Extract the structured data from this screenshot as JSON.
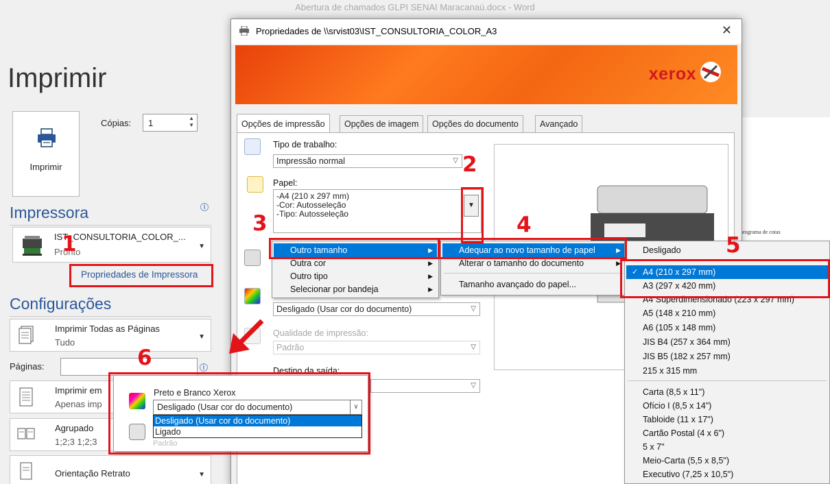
{
  "window_title": "Abertura de chamados GLPI SENAI Maracanaú.docx - Word",
  "backstage": {
    "title": "Imprimir",
    "print_button_label": "Imprimir",
    "copies_label": "Cópias:",
    "copies_value": "1",
    "printer_section": "Impressora",
    "printer_name": "IST_CONSULTORIA_COLOR_...",
    "printer_status": "Pronto",
    "printer_properties_link": "Propriedades de Impressora",
    "settings_section": "Configurações",
    "print_all": {
      "title": "Imprimir Todas as Páginas",
      "sub": "Tudo"
    },
    "pages_label": "Páginas:",
    "pages_value": "",
    "one_sided": {
      "title": "Imprimir em",
      "sub": "Apenas imp"
    },
    "collated": {
      "title": "Agrupado",
      "sub": "1;2;3    1;2;3"
    },
    "orientation": {
      "title": "Orientação Retrato"
    }
  },
  "preview": {
    "snippet": "o programa de cotas"
  },
  "dialog": {
    "title": "Propriedades de \\\\srvist03\\IST_CONSULTORIA_COLOR_A3",
    "close_glyph": "✕",
    "brand": "xerox",
    "tabs": [
      "Opções de impressão",
      "Opções de imagem",
      "Opções do documento",
      "Avançado"
    ],
    "job_type_label": "Tipo de trabalho:",
    "job_type_value": "Impressão normal",
    "paper_label": "Papel:",
    "paper_lines": [
      "-A4 (210 x 297 mm)",
      "-Cor: Autosseleção",
      "-Tipo: Autosseleção"
    ],
    "color_value": "Desligado (Usar cor do documento)",
    "quality_label": "Qualidade de impressão:",
    "quality_value": "Padrão",
    "output_label": "Destino da saída:"
  },
  "paper_menu": {
    "items": [
      "Outro tamanho",
      "Outra cor",
      "Outro tipo",
      "Selecionar por bandeja"
    ]
  },
  "size_menu": {
    "items": [
      "Adequar ao novo tamanho de papel",
      "Alterar o tamanho do documento",
      "Tamanho avançado do papel..."
    ]
  },
  "fit_menu": {
    "items": [
      "Desligado",
      "A4 (210 x 297 mm)",
      "A3 (297 x 420 mm)",
      "A4 Superdimensionado (223 x 297 mm)",
      "A5 (148 x 210 mm)",
      "A6 (105 x 148 mm)",
      "JIS B4 (257 x 364 mm)",
      "JIS B5 (182 x 257 mm)",
      "215 x 315 mm",
      "Carta (8,5 x 11\")",
      "Ofício I (8,5 x 14\")",
      "Tabloide (11 x 17\")",
      "Cartão Postal (4 x 6\")",
      "5 x 7\"",
      "Meio-Carta (5,5 x 8,5\")",
      "Executivo (7,25 x 10,5\")"
    ],
    "checked": "✓"
  },
  "color_popup": {
    "label": "Preto e Branco Xerox",
    "value": "Desligado (Usar cor do documento)",
    "options": [
      "Desligado (Usar cor do documento)",
      "Ligado"
    ],
    "ghost": "Padrão"
  },
  "annotations": [
    "1",
    "2",
    "3",
    "4",
    "5",
    "6"
  ],
  "colors": {
    "accent": "#2b579a",
    "highlight": "#0078d7",
    "annotation": "#e3131a"
  }
}
